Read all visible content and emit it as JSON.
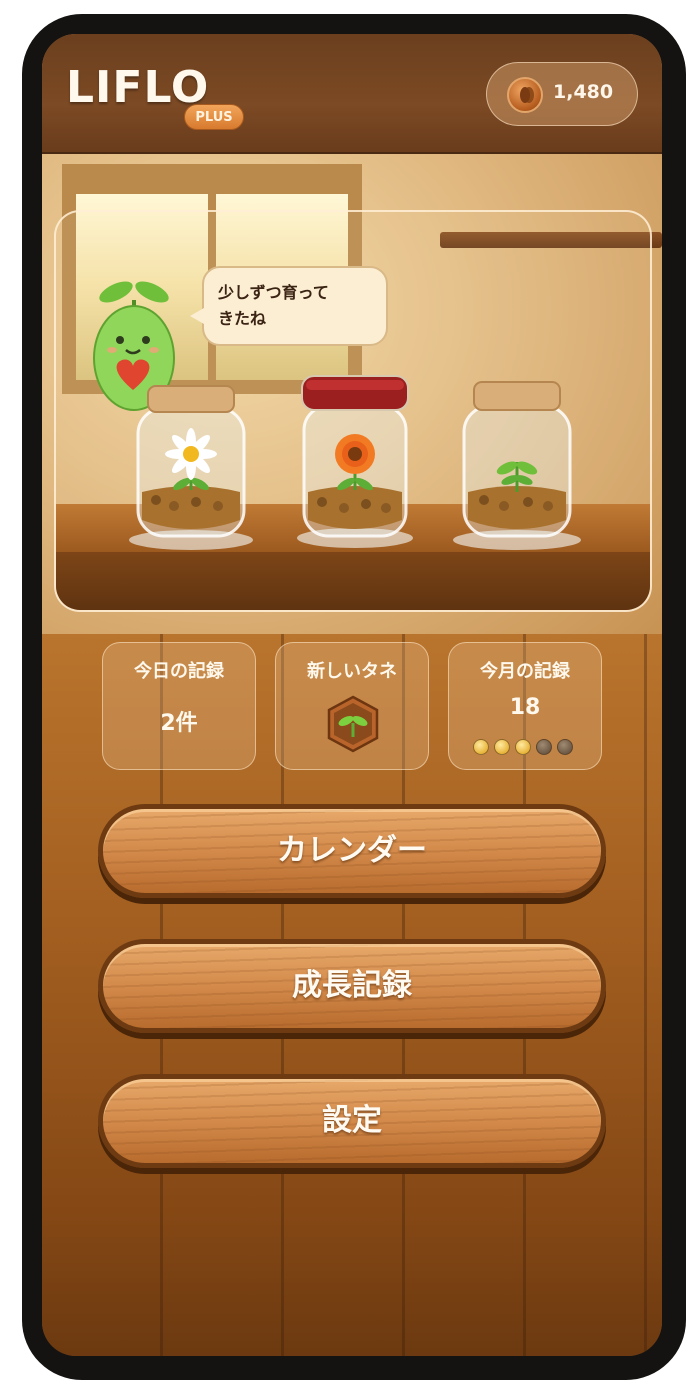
{
  "app": {
    "logo": "LIFLO",
    "plan_badge": "PLUS"
  },
  "header": {
    "coin_icon": "seed-coin-icon",
    "coin_count": "1,480"
  },
  "scene": {
    "speech_lines": [
      "少しずつ育って",
      "きたね"
    ],
    "jars": [
      {
        "lid": "cork",
        "plant": "white-daisy"
      },
      {
        "lid": "red",
        "plant": "orange-flower"
      },
      {
        "lid": "cork",
        "plant": "sprout"
      }
    ]
  },
  "stats": {
    "today": {
      "title": "今日の記録",
      "value": "2件"
    },
    "new_seed": {
      "title": "新しいタネ",
      "icon": "sprout-hex-icon"
    },
    "month": {
      "title": "今月の記録",
      "value": "18",
      "progress_filled": 3,
      "progress_total": 5
    }
  },
  "buttons": {
    "calendar": "カレンダー",
    "growth": "成長記録",
    "settings": "設定"
  },
  "colors": {
    "accent_wood": "#d38a4a",
    "frame": "#141311",
    "text_light": "#fff8ec"
  }
}
